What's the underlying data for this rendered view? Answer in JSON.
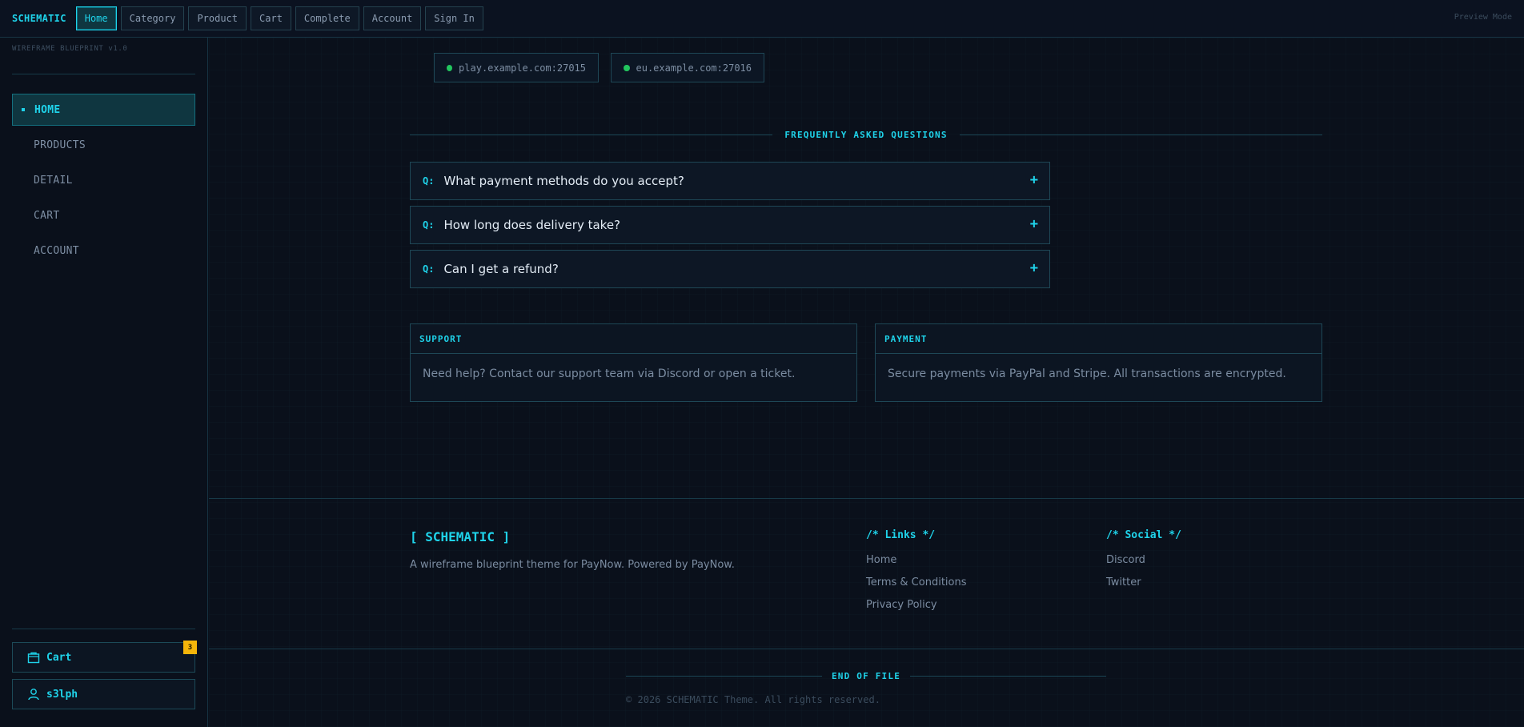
{
  "topbar": {
    "brand": "SCHEMATIC",
    "tabs": [
      {
        "label": "Home"
      },
      {
        "label": "Category"
      },
      {
        "label": "Product"
      },
      {
        "label": "Cart"
      },
      {
        "label": "Complete"
      },
      {
        "label": "Account"
      },
      {
        "label": "Sign In"
      }
    ],
    "active_tab": "Home",
    "mode": "Preview Mode"
  },
  "sidebar": {
    "caption": "WIREFRAME BLUEPRINT v1.0",
    "items": [
      {
        "label": "HOME"
      },
      {
        "label": "PRODUCTS"
      },
      {
        "label": "DETAIL"
      },
      {
        "label": "CART"
      },
      {
        "label": "ACCOUNT"
      }
    ],
    "cart": {
      "label": "Cart",
      "count": "3",
      "icon": "bag-icon"
    },
    "user": {
      "label": "s3lph",
      "icon": "user-icon"
    }
  },
  "servers": [
    {
      "address": "play.example.com:27015",
      "status": "online"
    },
    {
      "address": "eu.example.com:27016",
      "status": "online"
    }
  ],
  "faq": {
    "heading": "FREQUENTLY ASKED QUESTIONS",
    "prefix": "Q:",
    "items": [
      {
        "question": "What payment methods do you accept?"
      },
      {
        "question": "How long does delivery take?"
      },
      {
        "question": "Can I get a refund?"
      }
    ]
  },
  "cards": [
    {
      "title": "SUPPORT",
      "body": "Need help? Contact our support team via Discord or open a ticket."
    },
    {
      "title": "PAYMENT",
      "body": "Secure payments via PayPal and Stripe. All transactions are encrypted."
    }
  ],
  "footer": {
    "brand": "[ SCHEMATIC ]",
    "tagline": "A wireframe blueprint theme for PayNow. Powered by PayNow.",
    "links_heading": "/* Links */",
    "links": [
      {
        "label": "Home"
      },
      {
        "label": "Terms & Conditions"
      },
      {
        "label": "Privacy Policy"
      }
    ],
    "social_heading": "/* Social */",
    "social": [
      {
        "label": "Discord"
      },
      {
        "label": "Twitter"
      }
    ],
    "eof": "END OF FILE",
    "copyright": "© 2026 SCHEMATIC Theme. All rights reserved."
  },
  "colors": {
    "accent": "#1fd3ea",
    "background": "#0a101b",
    "border": "#1e4756",
    "online": "#22c55e",
    "badge": "#f5b50a"
  }
}
